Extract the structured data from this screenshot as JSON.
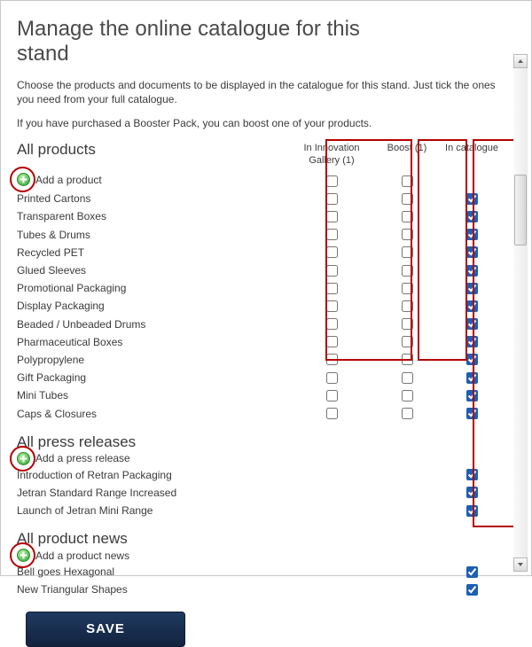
{
  "header": {
    "title": "Manage the online catalogue for this stand",
    "intro1": "Choose the products and documents to be displayed in the catalogue for this stand. Just tick the ones you need from your full catalogue.",
    "intro2": "If you have purchased a Booster Pack, you can boost one of your products."
  },
  "columns": {
    "innovation": "In Innovation Gallery (1)",
    "boost": "Boost (1)",
    "catalogue": "In catalogue"
  },
  "sections": [
    {
      "title": "All products",
      "add_label": "Add a product",
      "show_all_cols": true,
      "rows": [
        {
          "label": "Printed Cartons",
          "innovation": false,
          "boost": false,
          "catalogue": true
        },
        {
          "label": "Transparent Boxes",
          "innovation": false,
          "boost": false,
          "catalogue": true
        },
        {
          "label": "Tubes & Drums",
          "innovation": false,
          "boost": false,
          "catalogue": true
        },
        {
          "label": "Recycled PET",
          "innovation": false,
          "boost": false,
          "catalogue": true
        },
        {
          "label": "Glued Sleeves",
          "innovation": false,
          "boost": false,
          "catalogue": true
        },
        {
          "label": "Promotional Packaging",
          "innovation": false,
          "boost": false,
          "catalogue": true
        },
        {
          "label": "Display Packaging",
          "innovation": false,
          "boost": false,
          "catalogue": true
        },
        {
          "label": "Beaded / Unbeaded Drums",
          "innovation": false,
          "boost": false,
          "catalogue": true
        },
        {
          "label": "Pharmaceutical Boxes",
          "innovation": false,
          "boost": false,
          "catalogue": true
        },
        {
          "label": "Polypropylene",
          "innovation": false,
          "boost": false,
          "catalogue": true
        },
        {
          "label": "Gift Packaging",
          "innovation": false,
          "boost": false,
          "catalogue": true
        },
        {
          "label": "Mini Tubes",
          "innovation": false,
          "boost": false,
          "catalogue": true
        },
        {
          "label": "Caps & Closures",
          "innovation": false,
          "boost": false,
          "catalogue": true
        }
      ]
    },
    {
      "title": "All press releases",
      "add_label": "Add a press release",
      "show_all_cols": false,
      "rows": [
        {
          "label": "Introduction of Retran Packaging",
          "catalogue": true
        },
        {
          "label": "Jetran Standard Range Increased",
          "catalogue": true
        },
        {
          "label": "Launch of Jetran Mini Range",
          "catalogue": true
        }
      ]
    },
    {
      "title": "All product news",
      "add_label": "Add a product news",
      "show_all_cols": false,
      "rows": [
        {
          "label": "Bell goes Hexagonal",
          "catalogue": true
        },
        {
          "label": "New Triangular Shapes",
          "catalogue": true
        }
      ]
    }
  ],
  "buttons": {
    "save": "SAVE"
  },
  "icons": {
    "add": "plus-circle-icon"
  }
}
